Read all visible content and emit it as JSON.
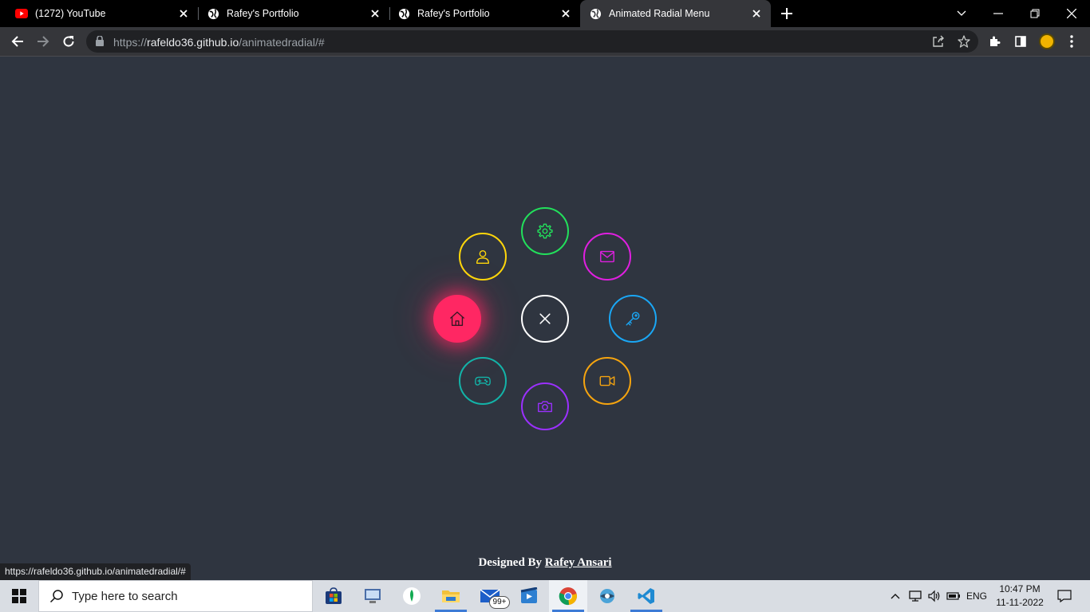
{
  "browser": {
    "tabs": [
      {
        "title": "(1272) YouTube",
        "icon": "youtube-icon"
      },
      {
        "title": "Rafey's Portfolio",
        "icon": "globe-icon"
      },
      {
        "title": "Rafey's Portfolio",
        "icon": "globe-icon"
      },
      {
        "title": "Animated Radial Menu",
        "icon": "globe-icon",
        "active": true
      }
    ],
    "url_scheme": "https://",
    "url_host": "rafeldo36.github.io",
    "url_path": "/animatedradial/#"
  },
  "page": {
    "menu_items": [
      {
        "name": "home",
        "icon": "home-icon",
        "color": "#ff2763",
        "active": true
      },
      {
        "name": "profile",
        "icon": "user-icon",
        "color": "#ffd60a"
      },
      {
        "name": "settings",
        "icon": "gear-icon",
        "color": "#22e05b"
      },
      {
        "name": "mail",
        "icon": "mail-icon",
        "color": "#e01fe0"
      },
      {
        "name": "key",
        "icon": "key-icon",
        "color": "#1aa7f5"
      },
      {
        "name": "video",
        "icon": "video-icon",
        "color": "#f5a40f"
      },
      {
        "name": "camera",
        "icon": "camera-icon",
        "color": "#9b30ff"
      },
      {
        "name": "gamepad",
        "icon": "gamepad-icon",
        "color": "#13b3a8"
      },
      {
        "name": "close",
        "icon": "close-icon",
        "color": "#ffffff"
      }
    ],
    "footer_prefix": "Designed By",
    "footer_author": "Rafey Ansari",
    "status_url": "https://rafeldo36.github.io/animatedradial/#"
  },
  "taskbar": {
    "search_placeholder": "Type here to search",
    "mail_badge": "99+",
    "language": "ENG",
    "time": "10:47 PM",
    "date": "11-11-2022"
  }
}
